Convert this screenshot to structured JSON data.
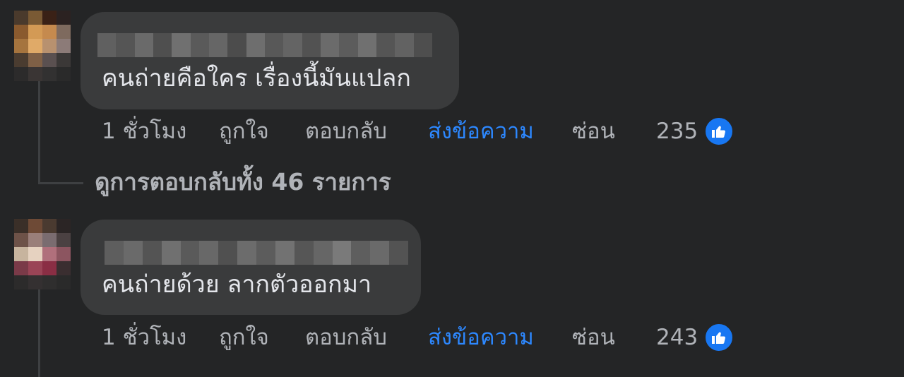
{
  "comments": [
    {
      "text": "คนถ่ายคือใคร เรื่องนี้มันแปลก",
      "actions": {
        "time": "1 ชั่วโมง",
        "like": "ถูกใจ",
        "reply": "ตอบกลับ",
        "message": "ส่งข้อความ",
        "hide": "ซ่อน",
        "like_count": "235"
      },
      "view_replies": "ดูการตอบกลับทั้ง 46 รายการ"
    },
    {
      "text": "คนถ่ายด้วย ลากตัวออกมา",
      "actions": {
        "time": "1 ชั่วโมง",
        "like": "ถูกใจ",
        "reply": "ตอบกลับ",
        "message": "ส่งข้อความ",
        "hide": "ซ่อน",
        "like_count": "243"
      }
    }
  ],
  "colors": {
    "background": "#242526",
    "bubble": "#3a3b3c",
    "accent_blue": "#2d88ff",
    "like_badge": "#1877f2",
    "muted_text": "#b0b3b8"
  },
  "icons": {
    "like_badge": "thumbs-up-icon"
  }
}
